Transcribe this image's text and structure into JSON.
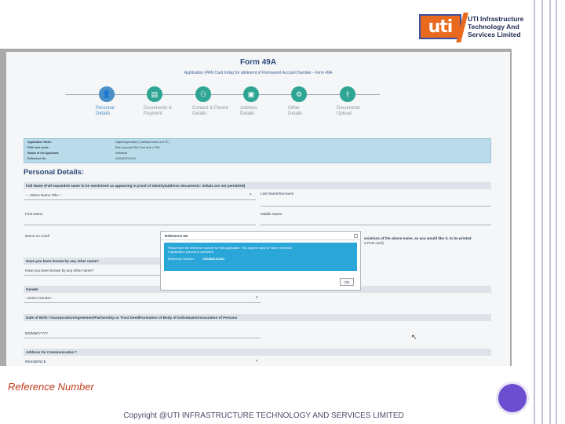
{
  "logo": {
    "mark": "uti",
    "line1": "UTI Infrastructure",
    "line2": "Technology And",
    "line3": "Services Limited"
  },
  "form": {
    "title": "Form 49A",
    "subtitle": "Application (PAN Card India) for allotment of Permanent Account Number - Form 49A"
  },
  "steps": [
    {
      "label1": "Personal",
      "label2": "Details",
      "icon": "user-icon",
      "glyph": "👤"
    },
    {
      "label1": "Documents &",
      "label2": "Payment",
      "icon": "document-icon",
      "glyph": "▤"
    },
    {
      "label1": "Contact & Parent",
      "label2": "Details",
      "icon": "parents-icon",
      "glyph": "⚇"
    },
    {
      "label1": "Address",
      "label2": "Details",
      "icon": "address-card-icon",
      "glyph": "▣"
    },
    {
      "label1": "Other",
      "label2": "Details",
      "icon": "settings-icon",
      "glyph": "⚙"
    },
    {
      "label1": "Documents",
      "label2": "Upload",
      "icon": "upload-icon",
      "glyph": "⇪"
    }
  ],
  "info": [
    {
      "key": "Application Mode:",
      "value": "Digital Application ( Aadhaar based e-KYC )"
    },
    {
      "key": "PAN card mode:",
      "value": "Both physical PAN Card and e-PAN"
    },
    {
      "key": "Status of the Applicant:",
      "value": "Individual"
    },
    {
      "key": "Reference No.",
      "value": "VN08020111011"
    }
  ],
  "personal_details": {
    "title": "Personal Details:",
    "full_name_bar": "Full Name (Full expanded name to be mentioned as appearing in proof of identity/address documents: initials are not permitted)",
    "title_select": "--- Select Name Title---",
    "last_name": "Last Name/Surname",
    "first_name": "First Name",
    "middle_name": "Middle Name",
    "name_on_card": "Name on Card*",
    "name_on_card_hint1": "eviations of the above name, as you would like it, to be printed",
    "name_on_card_hint2": "e-PAN card)",
    "known_by_bar": "Have you been known by any other name?",
    "known_by_value": "Have you been known by any other name?",
    "gender_bar": "Gender",
    "gender_value": "--Select Gender--",
    "dob_bar": "Date of Birth / Incorporation/Agreement/Partnership or Trust Deed/Formation of Body of Individuals/Association of Persons",
    "dob_value": "DD/MM/YYYY",
    "address_bar": "Address for Communication *",
    "address_value": "RESIDENCE"
  },
  "modal": {
    "title": "Reference No",
    "message1": "Please note the reference number for this application. This may be used for future reference",
    "message2": "if application process is cancelled.",
    "ref_label": "Reference Number:",
    "ref_value": "VN08020111NO",
    "ok_label": "Ok"
  },
  "caption": "Reference Number",
  "copyright": "Copyright @UTI INFRASTRUCTURE TECHNOLOGY AND SERVICES LIMITED"
}
